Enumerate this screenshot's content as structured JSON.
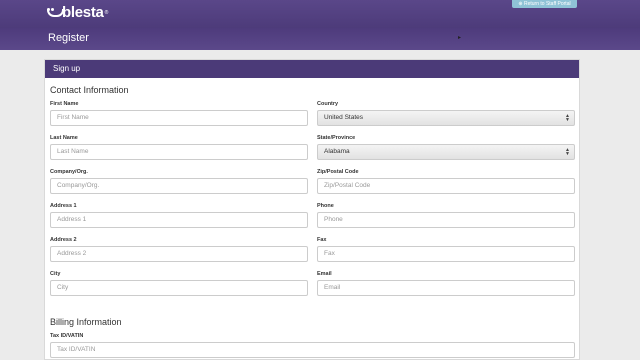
{
  "header": {
    "logo_text": "blesta",
    "logo_tm": "®",
    "return_button": "⊕ Return to Staff Portal"
  },
  "titlebar": {
    "title": "Register"
  },
  "panel": {
    "heading": "Sign up",
    "contact_title": "Contact Information",
    "billing_title": "Billing Information",
    "fields": {
      "first_name": {
        "label": "First Name",
        "placeholder": "First Name"
      },
      "last_name": {
        "label": "Last Name",
        "placeholder": "Last Name"
      },
      "company": {
        "label": "Company/Org.",
        "placeholder": "Company/Org."
      },
      "address1": {
        "label": "Address 1",
        "placeholder": "Address 1"
      },
      "address2": {
        "label": "Address 2",
        "placeholder": "Address 2"
      },
      "city": {
        "label": "City",
        "placeholder": "City"
      },
      "country": {
        "label": "Country",
        "value": "United States"
      },
      "state": {
        "label": "State/Province",
        "value": "Alabama"
      },
      "zip": {
        "label": "Zip/Postal Code",
        "placeholder": "Zip/Postal Code"
      },
      "phone": {
        "label": "Phone",
        "placeholder": "Phone"
      },
      "fax": {
        "label": "Fax",
        "placeholder": "Fax"
      },
      "email": {
        "label": "Email",
        "placeholder": "Email"
      },
      "tax_id": {
        "label": "Tax ID/VATIN",
        "placeholder": "Tax ID/VATIN"
      }
    }
  }
}
